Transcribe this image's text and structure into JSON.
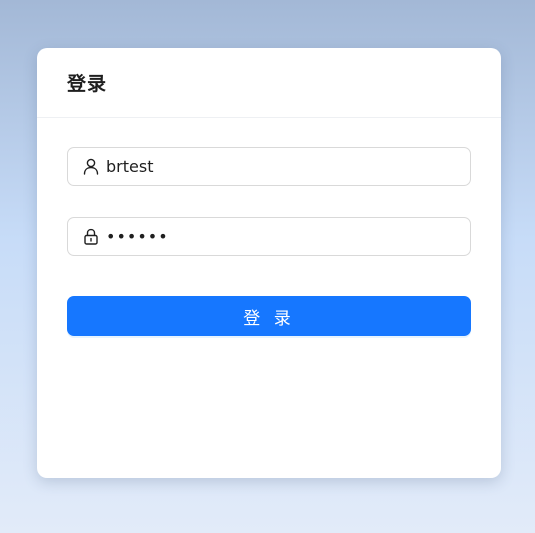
{
  "login_card": {
    "title": "登录",
    "username": {
      "value": "brtest",
      "icon": "user-icon"
    },
    "password": {
      "masked_value": "••••••",
      "icon": "lock-icon"
    },
    "submit_label": "登 录"
  },
  "colors": {
    "primary": "#1677ff",
    "border": "#d9d9d9",
    "title": "#1f1f1f"
  }
}
